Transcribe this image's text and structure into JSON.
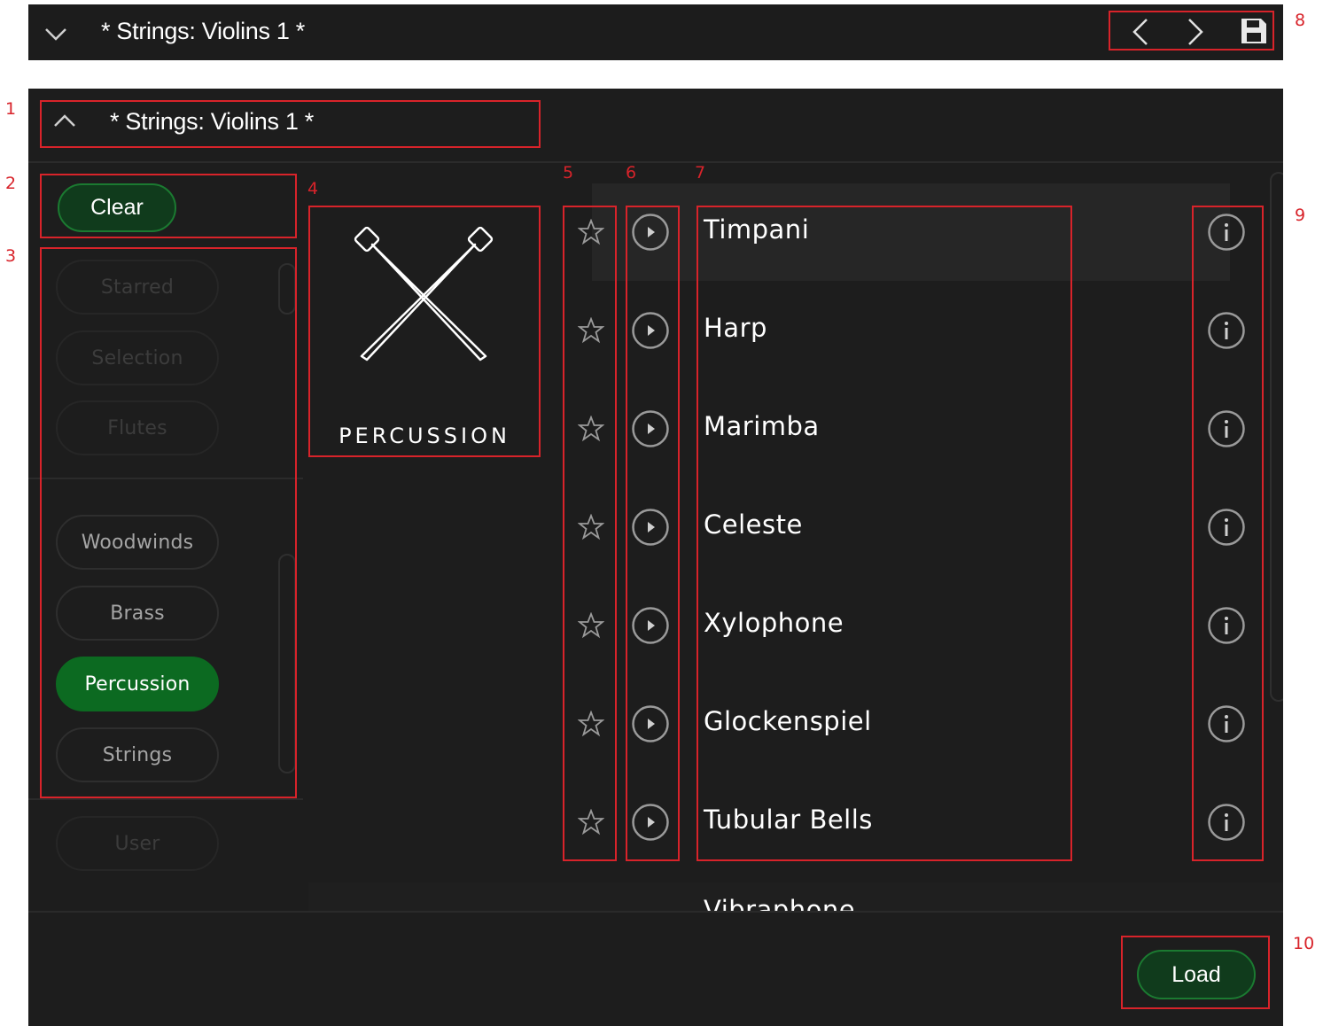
{
  "topbar": {
    "title": "* Strings: Violins 1 *"
  },
  "panel": {
    "title": "* Strings: Violins 1 *"
  },
  "filters": {
    "clear_label": "Clear",
    "top_items": [
      "Starred",
      "Selection",
      "Flutes"
    ],
    "categories": [
      {
        "label": "Woodwinds",
        "active": false
      },
      {
        "label": "Brass",
        "active": false
      },
      {
        "label": "Percussion",
        "active": true
      },
      {
        "label": "Strings",
        "active": false
      }
    ],
    "user_label": "User"
  },
  "category_tile": {
    "label": "PERCUSSION"
  },
  "instruments": [
    {
      "name": "Timpani",
      "highlighted": true
    },
    {
      "name": "Harp"
    },
    {
      "name": "Marimba"
    },
    {
      "name": "Celeste"
    },
    {
      "name": "Xylophone"
    },
    {
      "name": "Glockenspiel"
    },
    {
      "name": "Tubular Bells"
    }
  ],
  "next_instrument_partial": "Vibraphone",
  "footer": {
    "load_label": "Load"
  },
  "callouts": [
    "1",
    "2",
    "3",
    "4",
    "5",
    "6",
    "7",
    "8",
    "9",
    "10"
  ],
  "icons": {
    "collapse": "chevron-down-icon",
    "expand": "chevron-up-icon",
    "prev": "chevron-left-icon",
    "next": "chevron-right-icon",
    "save": "floppy-disk-icon",
    "star": "star-outline-icon",
    "play": "play-circle-icon",
    "info": "info-circle-icon",
    "category": "crossed-mallets-icon"
  },
  "colors": {
    "background": "#1d1d1d",
    "accent_green": "#0c6a21",
    "button_green_bg": "#103b1c",
    "annotation_red": "#d8232a"
  }
}
